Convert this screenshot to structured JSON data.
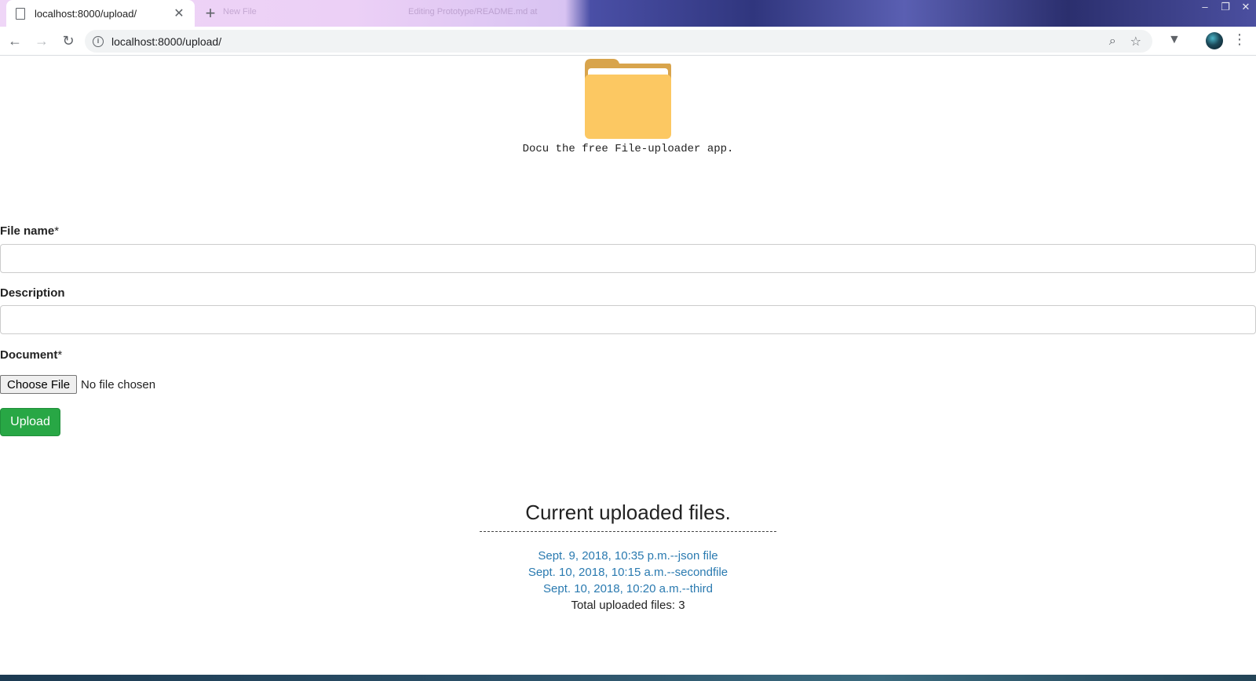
{
  "browser": {
    "tab_title": "localhost:8000/upload/",
    "ghost_tab_1": "New File",
    "ghost_tab_2": "Editing Prototype/README.md at",
    "url": "localhost:8000/upload/"
  },
  "app": {
    "tagline": "Docu the free File-uploader app."
  },
  "form": {
    "file_name_label": "File name",
    "description_label": "Description",
    "document_label": "Document",
    "required_mark": "*",
    "file_name_value": "",
    "description_value": "",
    "choose_file_label": "Choose File",
    "no_file_text": "No file chosen",
    "upload_label": "Upload"
  },
  "files": {
    "heading": "Current uploaded files.",
    "divider": "----------------------------------------------------------------------------",
    "items": [
      "Sept. 9, 2018, 10:35 p.m.--json file",
      "Sept. 10, 2018, 10:15 a.m.--secondfile",
      "Sept. 10, 2018, 10:20 a.m.--third"
    ],
    "total_text": "Total uploaded files: 3"
  },
  "colors": {
    "upload_button": "#28a745",
    "link": "#2a7ab0",
    "folder": "#fcc862"
  },
  "icons": [
    "back-icon",
    "forward-icon",
    "reload-icon",
    "info-icon",
    "zoom-icon",
    "star-icon",
    "extension-icon",
    "menu-icon",
    "folder-icon"
  ]
}
